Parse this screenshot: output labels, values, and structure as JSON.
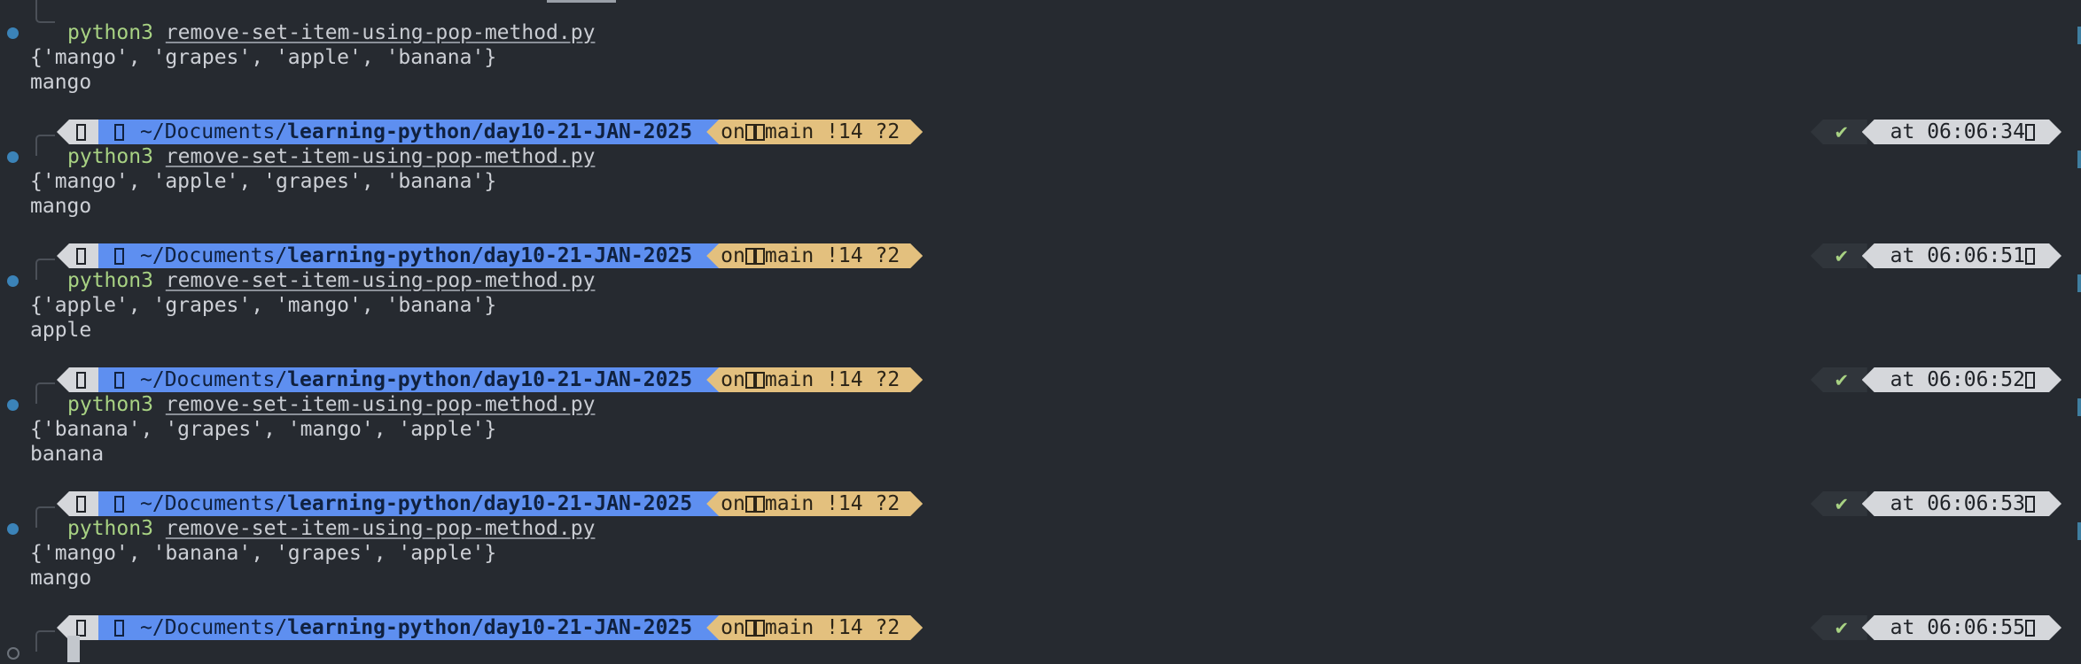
{
  "terminal": {
    "blocks": [
      {
        "command": "python3",
        "script": "remove-set-item-using-pop-method.py",
        "output": [
          "{'mango', 'grapes', 'apple', 'banana'}",
          "mango"
        ]
      },
      {
        "prompt": {
          "path_prefix": "~/Documents/",
          "path_bold": "learning-python/day10-21-JAN-2025",
          "git_on": "on",
          "branch": "main !14 ?2",
          "status": "✔",
          "time": "at 06:06:34"
        },
        "command": "python3",
        "script": "remove-set-item-using-pop-method.py",
        "output": [
          "{'mango', 'apple', 'grapes', 'banana'}",
          "mango"
        ]
      },
      {
        "prompt": {
          "path_prefix": "~/Documents/",
          "path_bold": "learning-python/day10-21-JAN-2025",
          "git_on": "on",
          "branch": "main !14 ?2",
          "status": "✔",
          "time": "at 06:06:51"
        },
        "command": "python3",
        "script": "remove-set-item-using-pop-method.py",
        "output": [
          "{'apple', 'grapes', 'mango', 'banana'}",
          "apple"
        ]
      },
      {
        "prompt": {
          "path_prefix": "~/Documents/",
          "path_bold": "learning-python/day10-21-JAN-2025",
          "git_on": "on",
          "branch": "main !14 ?2",
          "status": "✔",
          "time": "at 06:06:52"
        },
        "command": "python3",
        "script": "remove-set-item-using-pop-method.py",
        "output": [
          "{'banana', 'grapes', 'mango', 'apple'}",
          "banana"
        ]
      },
      {
        "prompt": {
          "path_prefix": "~/Documents/",
          "path_bold": "learning-python/day10-21-JAN-2025",
          "git_on": "on",
          "branch": "main !14 ?2",
          "status": "✔",
          "time": "at 06:06:53"
        },
        "command": "python3",
        "script": "remove-set-item-using-pop-method.py",
        "output": [
          "{'mango', 'banana', 'grapes', 'apple'}",
          "mango"
        ]
      }
    ],
    "final_prompt": {
      "path_prefix": "~/Documents/",
      "path_bold": "learning-python/day10-21-JAN-2025",
      "git_on": "on",
      "branch": "main !14 ?2",
      "status": "✔",
      "time": "at 06:06:55"
    }
  },
  "icons": {
    "os": "apple-logo-icon",
    "folder": "folder-icon",
    "git": "git-logo-icon",
    "branch": "branch-icon",
    "clock": "clock-icon",
    "status": "check-icon"
  },
  "colors": {
    "background": "#262a30",
    "path_segment": "#5e8ff0",
    "git_segment": "#e3c07e",
    "os_segment": "#d5d7db",
    "ok": "#a8d283",
    "command": "#a8d283",
    "marker": "#3b83b8"
  }
}
